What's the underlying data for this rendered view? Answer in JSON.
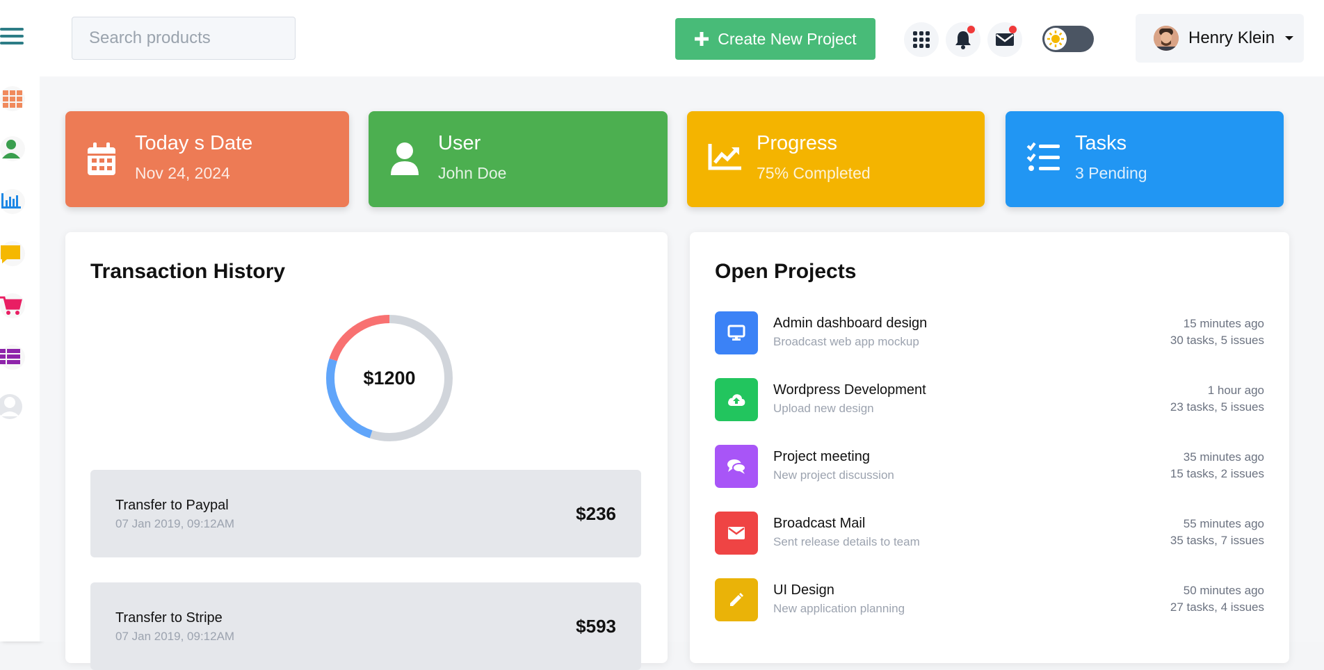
{
  "topbar": {
    "search_placeholder": "Search products",
    "create_button_label": "Create New Project",
    "user_name": "Henry Klein"
  },
  "sidebar": {
    "items": [
      {
        "icon": "menu-icon",
        "color": "#2d7d86"
      },
      {
        "icon": "grid-icon",
        "color": "#f08a5d"
      },
      {
        "icon": "user-icon",
        "color": "#3a9e4e"
      },
      {
        "icon": "bar-chart-icon",
        "color": "#1e88e5"
      },
      {
        "icon": "chat-icon",
        "color": "#f5b800"
      },
      {
        "icon": "cart-icon",
        "color": "#e91e63"
      },
      {
        "icon": "table-icon",
        "color": "#8e24aa"
      },
      {
        "icon": "profile-icon",
        "color": "#e5e7eb"
      }
    ]
  },
  "stats": [
    {
      "title": "Today s Date",
      "subtitle": "Nov 24, 2024",
      "icon": "calendar-icon",
      "color": "#ed7b55"
    },
    {
      "title": "User",
      "subtitle": "John Doe",
      "icon": "user-icon",
      "color": "#4caf50"
    },
    {
      "title": "Progress",
      "subtitle": "75% Completed",
      "icon": "trend-up-icon",
      "color": "#f4b400"
    },
    {
      "title": "Tasks",
      "subtitle": "3 Pending",
      "icon": "task-list-icon",
      "color": "#2196f3"
    }
  ],
  "transactions": {
    "title": "Transaction History",
    "total": "$1200",
    "donut_segments": [
      {
        "color": "#d1d5db",
        "fraction": 0.55
      },
      {
        "color": "#60a5fa",
        "fraction": 0.25
      },
      {
        "color": "#f87171",
        "fraction": 0.2
      }
    ],
    "items": [
      {
        "title": "Transfer to Paypal",
        "date": "07 Jan 2019, 09:12AM",
        "amount": "$236"
      },
      {
        "title": "Transfer to Stripe",
        "date": "07 Jan 2019, 09:12AM",
        "amount": "$593"
      }
    ]
  },
  "projects": {
    "title": "Open Projects",
    "items": [
      {
        "name": "Admin dashboard design",
        "desc": "Broadcast web app mockup",
        "time": "15 minutes ago",
        "stats": "30 tasks, 5 issues",
        "icon": "monitor-icon",
        "color": "#3b82f6"
      },
      {
        "name": "Wordpress Development",
        "desc": "Upload new design",
        "time": "1 hour ago",
        "stats": "23 tasks, 5 issues",
        "icon": "cloud-upload-icon",
        "color": "#22c55e"
      },
      {
        "name": "Project meeting",
        "desc": "New project discussion",
        "time": "35 minutes ago",
        "stats": "15 tasks, 2 issues",
        "icon": "chat-bubbles-icon",
        "color": "#a855f7"
      },
      {
        "name": "Broadcast Mail",
        "desc": "Sent release details to team",
        "time": "55 minutes ago",
        "stats": "35 tasks, 7 issues",
        "icon": "mail-icon",
        "color": "#ef4444"
      },
      {
        "name": "UI Design",
        "desc": "New application planning",
        "time": "50 minutes ago",
        "stats": "27 tasks, 4 issues",
        "icon": "pencil-icon",
        "color": "#eab308"
      }
    ]
  }
}
